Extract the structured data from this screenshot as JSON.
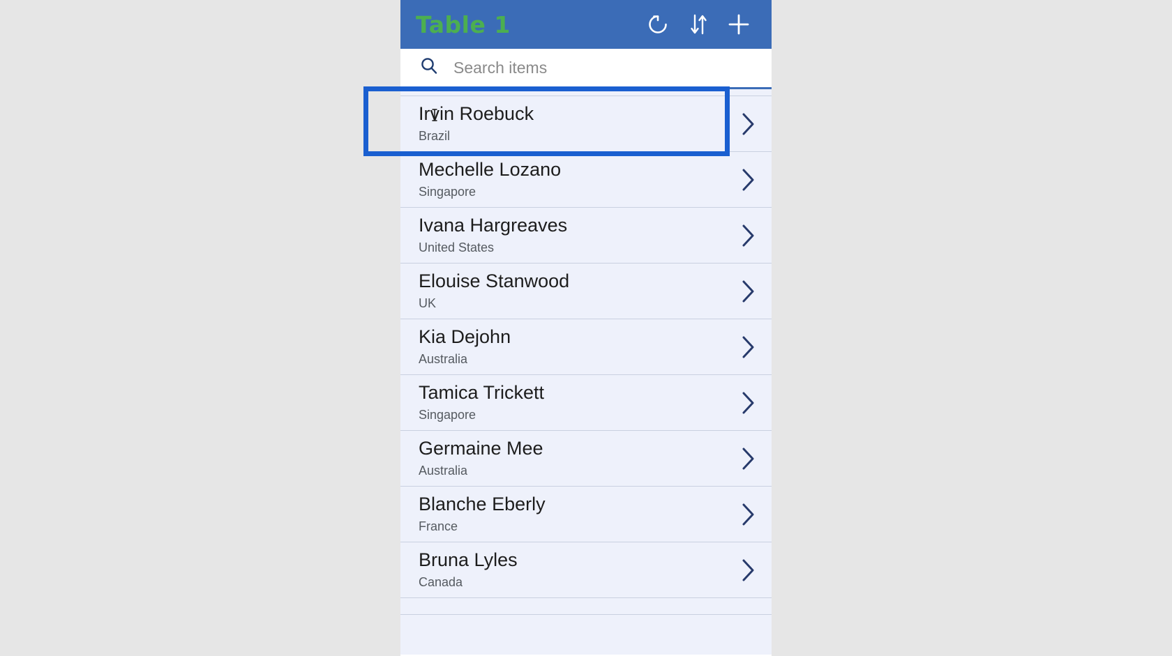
{
  "window": {
    "header": {
      "title": "Table 1",
      "title_color": "#4caf50",
      "background_color": "#3b6cb7",
      "refresh_icon": "refresh-icon",
      "sort_icon": "sort-ascending-descending-icon",
      "add_icon": "plus-icon"
    },
    "search": {
      "icon": "search-icon",
      "placeholder": "Search items",
      "value": ""
    },
    "list": {
      "partial_top_row": {
        "title": "",
        "subtitle": ""
      },
      "rows": [
        {
          "title": "Irvin Roebuck",
          "subtitle": "Brazil",
          "chevron": "chevron-right-icon",
          "selected": true
        },
        {
          "title": "Mechelle Lozano",
          "subtitle": "Singapore",
          "chevron": "chevron-right-icon",
          "selected": false
        },
        {
          "title": "Ivana Hargreaves",
          "subtitle": "United States",
          "chevron": "chevron-right-icon",
          "selected": false
        },
        {
          "title": "Elouise Stanwood",
          "subtitle": "UK",
          "chevron": "chevron-right-icon",
          "selected": false
        },
        {
          "title": "Kia Dejohn",
          "subtitle": "Australia",
          "chevron": "chevron-right-icon",
          "selected": false
        },
        {
          "title": "Tamica Trickett",
          "subtitle": "Singapore",
          "chevron": "chevron-right-icon",
          "selected": false
        },
        {
          "title": "Germaine Mee",
          "subtitle": "Australia",
          "chevron": "chevron-right-icon",
          "selected": false
        },
        {
          "title": "Blanche Eberly",
          "subtitle": "France",
          "chevron": "chevron-right-icon",
          "selected": false
        },
        {
          "title": "Bruna Lyles",
          "subtitle": "Canada",
          "chevron": "chevron-right-icon",
          "selected": false
        }
      ]
    },
    "selection": {
      "target_row_title": "Irvin Roebuck",
      "border_color": "#1a5fd0"
    },
    "cursor": {
      "type": "text-ibeam-cursor"
    }
  },
  "colors": {
    "page_background": "#e6e6e6",
    "header_blue": "#3b6cb7",
    "accent_blue": "#1a5fd0",
    "list_background": "#eef1fb",
    "row_divider": "#c9d0e0",
    "title_green": "#4caf50",
    "chevron_navy": "#273a6b"
  }
}
